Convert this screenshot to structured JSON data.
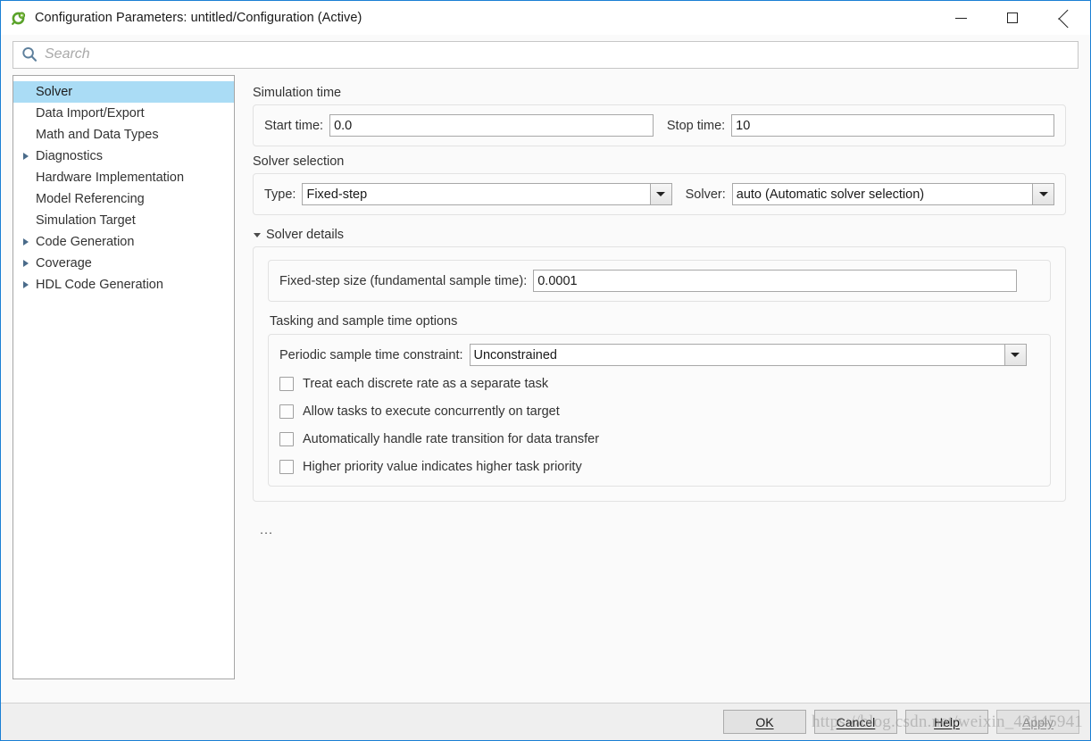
{
  "window": {
    "title": "Configuration Parameters: untitled/Configuration (Active)",
    "app_icon": "simulink-icon",
    "minimize_label": "Minimize",
    "maximize_label": "Maximize",
    "close_label": "Close",
    "accent_border": "#1a7fd4"
  },
  "search": {
    "placeholder": "Search",
    "value": "",
    "icon": "search-icon"
  },
  "tree": {
    "items": [
      {
        "label": "Solver",
        "expandable": false,
        "selected": true
      },
      {
        "label": "Data Import/Export",
        "expandable": false,
        "selected": false
      },
      {
        "label": "Math and Data Types",
        "expandable": false,
        "selected": false
      },
      {
        "label": "Diagnostics",
        "expandable": true,
        "selected": false
      },
      {
        "label": "Hardware Implementation",
        "expandable": false,
        "selected": false
      },
      {
        "label": "Model Referencing",
        "expandable": false,
        "selected": false
      },
      {
        "label": "Simulation Target",
        "expandable": false,
        "selected": false
      },
      {
        "label": "Code Generation",
        "expandable": true,
        "selected": false
      },
      {
        "label": "Coverage",
        "expandable": true,
        "selected": false
      },
      {
        "label": "HDL Code Generation",
        "expandable": true,
        "selected": false
      }
    ],
    "selection_color": "#aadcf5"
  },
  "main": {
    "simulation_time": {
      "title": "Simulation time",
      "start_time_label": "Start time:",
      "start_time_value": "0.0",
      "stop_time_label": "Stop time:",
      "stop_time_value": "10"
    },
    "solver_selection": {
      "title": "Solver selection",
      "type_label": "Type:",
      "type_value": "Fixed-step",
      "solver_label": "Solver:",
      "solver_value": "auto (Automatic solver selection)"
    },
    "solver_details": {
      "expander_label": "Solver details",
      "expanded": true,
      "fixed_step_label": "Fixed-step size (fundamental sample time):",
      "fixed_step_value": "0.0001",
      "tasking_title": "Tasking and sample time options",
      "constraint_label": "Periodic sample time constraint:",
      "constraint_value": "Unconstrained",
      "checkboxes": [
        {
          "label": "Treat each discrete rate as a separate task",
          "checked": false
        },
        {
          "label": "Allow tasks to execute concurrently on target",
          "checked": false
        },
        {
          "label": "Automatically handle rate transition for data transfer",
          "checked": false
        },
        {
          "label": "Higher priority value indicates higher task priority",
          "checked": false
        }
      ]
    },
    "overflow_indicator": "..."
  },
  "footer": {
    "buttons": [
      {
        "label": "OK",
        "mnemonic_index": 0,
        "enabled": true
      },
      {
        "label": "Cancel",
        "mnemonic_index": 0,
        "enabled": true
      },
      {
        "label": "Help",
        "mnemonic_index": 0,
        "enabled": true
      },
      {
        "label": "Apply",
        "mnemonic_index": 0,
        "enabled": false
      }
    ]
  },
  "watermark": {
    "text": "https://blog.csdn.net/weixin_43145941"
  }
}
